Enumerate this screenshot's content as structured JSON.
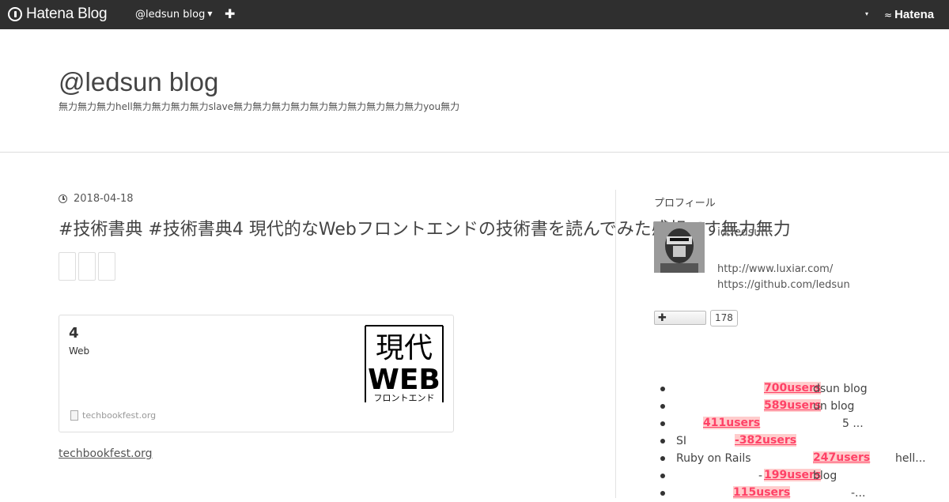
{
  "topbar": {
    "logo": "Hatena Blog",
    "blog_menu": "@ledsun blog",
    "add_label": "✚",
    "right_caret": "▾",
    "hatena_label": "Hatena"
  },
  "header": {
    "title": "@ledsun blog",
    "description": "無力無力無力hell無力無力無力無力slave無力無力無力無力無力無力無力無力無力無力you無力"
  },
  "entry": {
    "date": "2018-04-18",
    "title": "#技術書典 #技術書典4 現代的なWebフロントエンドの技術書を読んでみた感想です無力無力",
    "card": {
      "title": "4",
      "subtitle": "Web",
      "thumb_line1": "現代",
      "thumb_line2": "WEB",
      "thumb_line3": "フロントエンド",
      "site": "techbookfest.org"
    },
    "link_text": "techbookfest.org"
  },
  "sidebar": {
    "heading": "プロフィール",
    "profile_id": "id:ledsun",
    "link1": "http://www.luxiar.com/",
    "link2": "https://github.com/ledsun",
    "follow_label": "✚",
    "follow_count": "178",
    "entries": [
      {
        "prefix": "",
        "users": "700users",
        "suffix": "dsun blog"
      },
      {
        "prefix": "",
        "users": "589users",
        "suffix": "un blog"
      },
      {
        "prefix": "",
        "users": "411users",
        "suffix": "5   ..."
      },
      {
        "prefix": "SI",
        "users": "-382users",
        "suffix": ""
      },
      {
        "prefix": "Ruby on Rails",
        "users": "247users",
        "suffix": "hell..."
      },
      {
        "prefix": "-",
        "users": "199users",
        "suffix": "blog"
      },
      {
        "prefix": "",
        "users": "115users",
        "suffix": "-..."
      }
    ]
  }
}
